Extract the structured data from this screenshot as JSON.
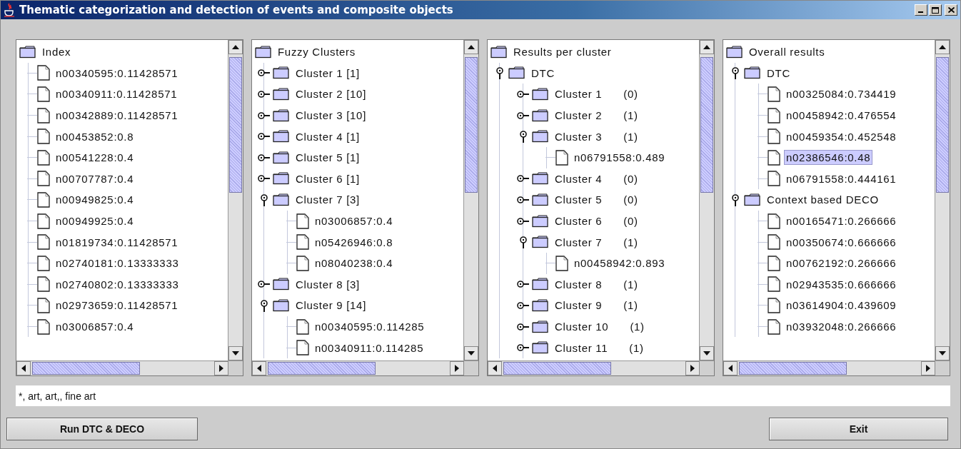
{
  "window": {
    "title": "Thematic categorization and detection of events and composite objects"
  },
  "panels": [
    {
      "label": "Index",
      "selected": false,
      "children": [
        {
          "kind": "leaf",
          "label": "n00340595:0.11428571",
          "selected": false
        },
        {
          "kind": "leaf",
          "label": "n00340911:0.11428571",
          "selected": false
        },
        {
          "kind": "leaf",
          "label": "n00342889:0.11428571",
          "selected": false
        },
        {
          "kind": "leaf",
          "label": "n00453852:0.8",
          "selected": false
        },
        {
          "kind": "leaf",
          "label": "n00541228:0.4",
          "selected": false
        },
        {
          "kind": "leaf",
          "label": "n00707787:0.4",
          "selected": false
        },
        {
          "kind": "leaf",
          "label": "n00949825:0.4",
          "selected": false
        },
        {
          "kind": "leaf",
          "label": "n00949925:0.4",
          "selected": false
        },
        {
          "kind": "leaf",
          "label": "n01819734:0.11428571",
          "selected": false
        },
        {
          "kind": "leaf",
          "label": "n02740181:0.13333333",
          "selected": false
        },
        {
          "kind": "leaf",
          "label": "n02740802:0.13333333",
          "selected": false
        },
        {
          "kind": "leaf",
          "label": "n02973659:0.11428571",
          "selected": false
        },
        {
          "kind": "leaf",
          "label": "n03006857:0.4",
          "selected": false
        }
      ]
    },
    {
      "label": "Fuzzy Clusters",
      "selected": false,
      "children": [
        {
          "kind": "folder",
          "label": "Cluster 1 [1]",
          "expanded": false,
          "selected": false
        },
        {
          "kind": "folder",
          "label": "Cluster 2 [10]",
          "expanded": false,
          "selected": false
        },
        {
          "kind": "folder",
          "label": "Cluster 3 [10]",
          "expanded": false,
          "selected": false
        },
        {
          "kind": "folder",
          "label": "Cluster 4 [1]",
          "expanded": false,
          "selected": false
        },
        {
          "kind": "folder",
          "label": "Cluster 5 [1]",
          "expanded": false,
          "selected": false
        },
        {
          "kind": "folder",
          "label": "Cluster 6 [1]",
          "expanded": false,
          "selected": false
        },
        {
          "kind": "folder",
          "label": "Cluster 7 [3]",
          "expanded": true,
          "selected": false,
          "children": [
            {
              "kind": "leaf",
              "label": "n03006857:0.4",
              "selected": false
            },
            {
              "kind": "leaf",
              "label": "n05426946:0.8",
              "selected": false
            },
            {
              "kind": "leaf",
              "label": "n08040238:0.4",
              "selected": false
            }
          ]
        },
        {
          "kind": "folder",
          "label": "Cluster 8 [3]",
          "expanded": false,
          "selected": false
        },
        {
          "kind": "folder",
          "label": "Cluster 9 [14]",
          "expanded": true,
          "selected": false,
          "children": [
            {
              "kind": "leaf",
              "label": "n00340595:0.114285",
              "selected": false
            },
            {
              "kind": "leaf",
              "label": "n00340911:0.114285",
              "selected": false
            }
          ]
        }
      ]
    },
    {
      "label": "Results per cluster",
      "selected": false,
      "children": [
        {
          "kind": "folder",
          "label": "DTC",
          "expanded": true,
          "selected": false,
          "children": [
            {
              "kind": "folder",
              "label": "Cluster 1",
              "count": "(0)",
              "expanded": false,
              "selected": false
            },
            {
              "kind": "folder",
              "label": "Cluster 2",
              "count": "(1)",
              "expanded": false,
              "selected": false
            },
            {
              "kind": "folder",
              "label": "Cluster 3",
              "count": "(1)",
              "expanded": true,
              "selected": false,
              "children": [
                {
                  "kind": "leaf",
                  "label": "n06791558:0.489",
                  "selected": false
                }
              ]
            },
            {
              "kind": "folder",
              "label": "Cluster 4",
              "count": "(0)",
              "expanded": false,
              "selected": false
            },
            {
              "kind": "folder",
              "label": "Cluster 5",
              "count": "(0)",
              "expanded": false,
              "selected": false
            },
            {
              "kind": "folder",
              "label": "Cluster 6",
              "count": "(0)",
              "expanded": false,
              "selected": false
            },
            {
              "kind": "folder",
              "label": "Cluster 7",
              "count": "(1)",
              "expanded": true,
              "selected": false,
              "children": [
                {
                  "kind": "leaf",
                  "label": "n00458942:0.893",
                  "selected": false
                }
              ]
            },
            {
              "kind": "folder",
              "label": "Cluster 8",
              "count": "(1)",
              "expanded": false,
              "selected": false
            },
            {
              "kind": "folder",
              "label": "Cluster 9",
              "count": "(1)",
              "expanded": false,
              "selected": false
            },
            {
              "kind": "folder",
              "label": "Cluster 10",
              "count": "(1)",
              "expanded": false,
              "selected": false
            },
            {
              "kind": "folder",
              "label": "Cluster 11",
              "count": "(1)",
              "expanded": false,
              "selected": false
            }
          ]
        }
      ]
    },
    {
      "label": "Overall results",
      "selected": false,
      "children": [
        {
          "kind": "folder",
          "label": "DTC",
          "expanded": true,
          "selected": false,
          "children": [
            {
              "kind": "leaf",
              "label": "n00325084:0.734419",
              "selected": false
            },
            {
              "kind": "leaf",
              "label": "n00458942:0.476554",
              "selected": false
            },
            {
              "kind": "leaf",
              "label": "n00459354:0.452548",
              "selected": false
            },
            {
              "kind": "leaf",
              "label": "n02386546:0.48",
              "selected": true
            },
            {
              "kind": "leaf",
              "label": "n06791558:0.444161",
              "selected": false
            }
          ]
        },
        {
          "kind": "folder",
          "label": "Context based DECO",
          "expanded": true,
          "selected": false,
          "children": [
            {
              "kind": "leaf",
              "label": "n00165471:0.266666",
              "selected": false
            },
            {
              "kind": "leaf",
              "label": "n00350674:0.666666",
              "selected": false
            },
            {
              "kind": "leaf",
              "label": "n00762192:0.266666",
              "selected": false
            },
            {
              "kind": "leaf",
              "label": "n02943535:0.666666",
              "selected": false
            },
            {
              "kind": "leaf",
              "label": "n03614904:0.439609",
              "selected": false
            },
            {
              "kind": "leaf",
              "label": "n03932048:0.266666",
              "selected": false
            }
          ]
        }
      ]
    }
  ],
  "query_field": {
    "value": "*, art, art,, fine art"
  },
  "buttons": [
    {
      "label": "Run DTC & DECO"
    },
    {
      "label": "Exit"
    }
  ]
}
